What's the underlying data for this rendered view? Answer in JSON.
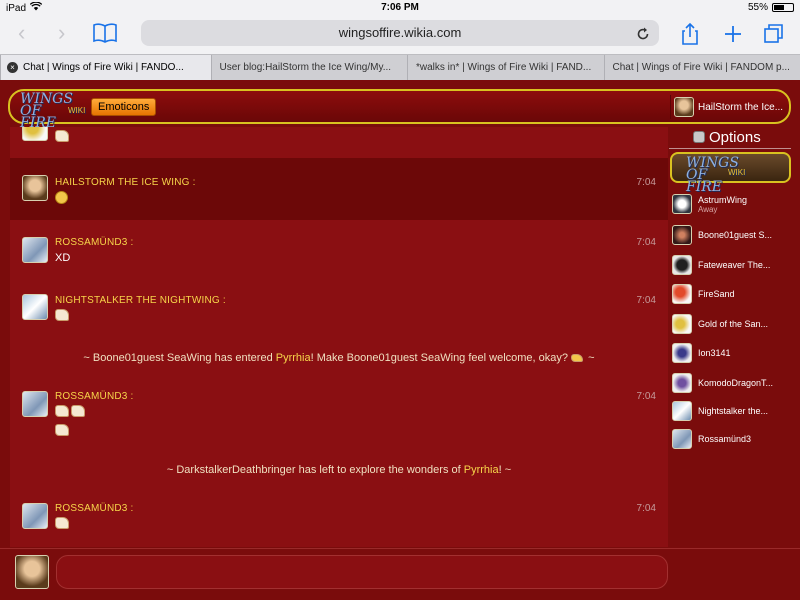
{
  "status_bar": {
    "device": "iPad",
    "time": "7:06 PM",
    "battery": "55%",
    "battery_level": 0.55
  },
  "toolbar": {
    "url": "wingsoffire.wikia.com"
  },
  "tabs": [
    {
      "label": "Chat | Wings of Fire Wiki | FANDO..."
    },
    {
      "label": "User blog:HailStorm the Ice Wing/My..."
    },
    {
      "label": "*walks in* | Wings of Fire Wiki | FAND..."
    },
    {
      "label": "Chat | Wings of Fire Wiki | FANDOM p..."
    }
  ],
  "header": {
    "logo_text": "WINGS OF FIRE",
    "logo_wiki": "WIKI",
    "emoticons_label": "Emoticons",
    "user_name": "HailStorm the Ice..."
  },
  "messages": [
    {
      "author": "HAILSTORM THE ICE WING :",
      "time": "7:04"
    },
    {
      "author": "ROSSAMÜND3 :",
      "time": "7:04",
      "text": "XD"
    },
    {
      "author": "NIGHTSTALKER THE NIGHTWING :",
      "time": "7:04"
    },
    {
      "author": "ROSSAMÜND3 :",
      "time": "7:04"
    },
    {
      "author": "ROSSAMÜND3 :",
      "time": "7:04"
    }
  ],
  "inline": [
    {
      "before": "~ Boone01guest SeaWing has entered ",
      "place": "Pyrrhia",
      "after": "! Make Boone01guest SeaWing feel welcome, okay?",
      "tail": "~"
    },
    {
      "before": "~ DarkstalkerDeathbringer has left to explore the wonders of ",
      "place": "Pyrrhia",
      "after": "! ~"
    }
  ],
  "sidebar": {
    "options_label": "Options",
    "users": [
      {
        "name": "AstrumWing",
        "status": "Away"
      },
      {
        "name": "Boone01guest S..."
      },
      {
        "name": "Fateweaver The..."
      },
      {
        "name": "FireSand"
      },
      {
        "name": "Gold of the San..."
      },
      {
        "name": "Ion3141"
      },
      {
        "name": "KomodoDragonT..."
      },
      {
        "name": "Nightstalker the..."
      },
      {
        "name": "Rossamünd3"
      }
    ]
  },
  "input": {
    "value": ""
  }
}
